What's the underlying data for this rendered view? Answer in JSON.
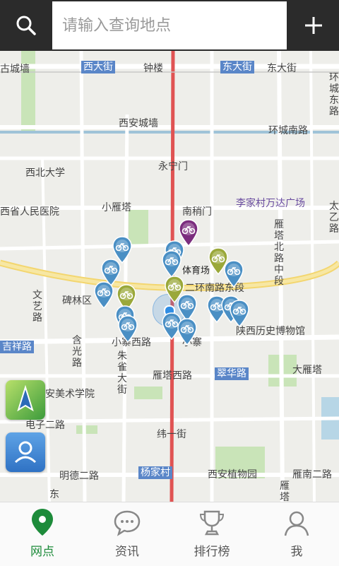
{
  "search": {
    "placeholder": "请输入查询地点"
  },
  "map": {
    "labels": {
      "gucheng_wall": "古城墙",
      "xi_dajie": "西大街",
      "zhonglou": "钟楼",
      "dong_dajie": "东大街",
      "dong_dajie_2": "东大街",
      "huan_bei": "环城东路",
      "xian_chengqiang": "西安城墙",
      "huancheng_nanlu": "环城南路",
      "xibei_daxue": "西北大学",
      "yongning_men": "永宁门",
      "hospital": "西省人民医院",
      "xiaoyan_ta": "小雁塔",
      "nanshao_men": "南稍门",
      "wanda": "李家村万达广场",
      "taiyi_lu": "太乙路",
      "yanta_beilu": "雁塔北路中段",
      "tiyuchang": "体育场",
      "er_huan": "二环南路东段",
      "beilin": "碑林区",
      "wenyi_lu": "文艺路",
      "shaanxi_museum": "陕西历史博物馆",
      "jixiang_lu": "吉祥路",
      "xiao_zhai": "小寨",
      "xiao_zhai_xi": "小寨西路",
      "hanguang_lu": "含光路",
      "zhuque_dajie": "朱雀大街",
      "cuihua_lu": "翠华路",
      "dayan_ta": "大雁塔",
      "meishu_xueyuan": "安美术学院",
      "yanta_xilu": "雁塔西路",
      "dianzi_erlu": "电子二路",
      "wei_yi_jie": "纬一街",
      "mingde_erlu": "明德二路",
      "yangjia_cun": "杨家村",
      "zhiwuyuan": "西安植物园",
      "yannan_erlu": "雁南二路",
      "dong": "东",
      "yanta": "雁塔"
    }
  },
  "tabs": [
    {
      "label": "网点",
      "icon": "location-pin-icon",
      "active": true
    },
    {
      "label": "资讯",
      "icon": "chat-bubble-icon",
      "active": false
    },
    {
      "label": "排行榜",
      "icon": "trophy-icon",
      "active": false
    },
    {
      "label": "我",
      "icon": "user-icon",
      "active": false
    }
  ],
  "colors": {
    "topbar": "#2b2b2b",
    "accent": "#1d8b3a",
    "pin_blue": "#4a8fc4",
    "pin_green": "#9aa83a",
    "pin_purple": "#7b2d7e"
  }
}
